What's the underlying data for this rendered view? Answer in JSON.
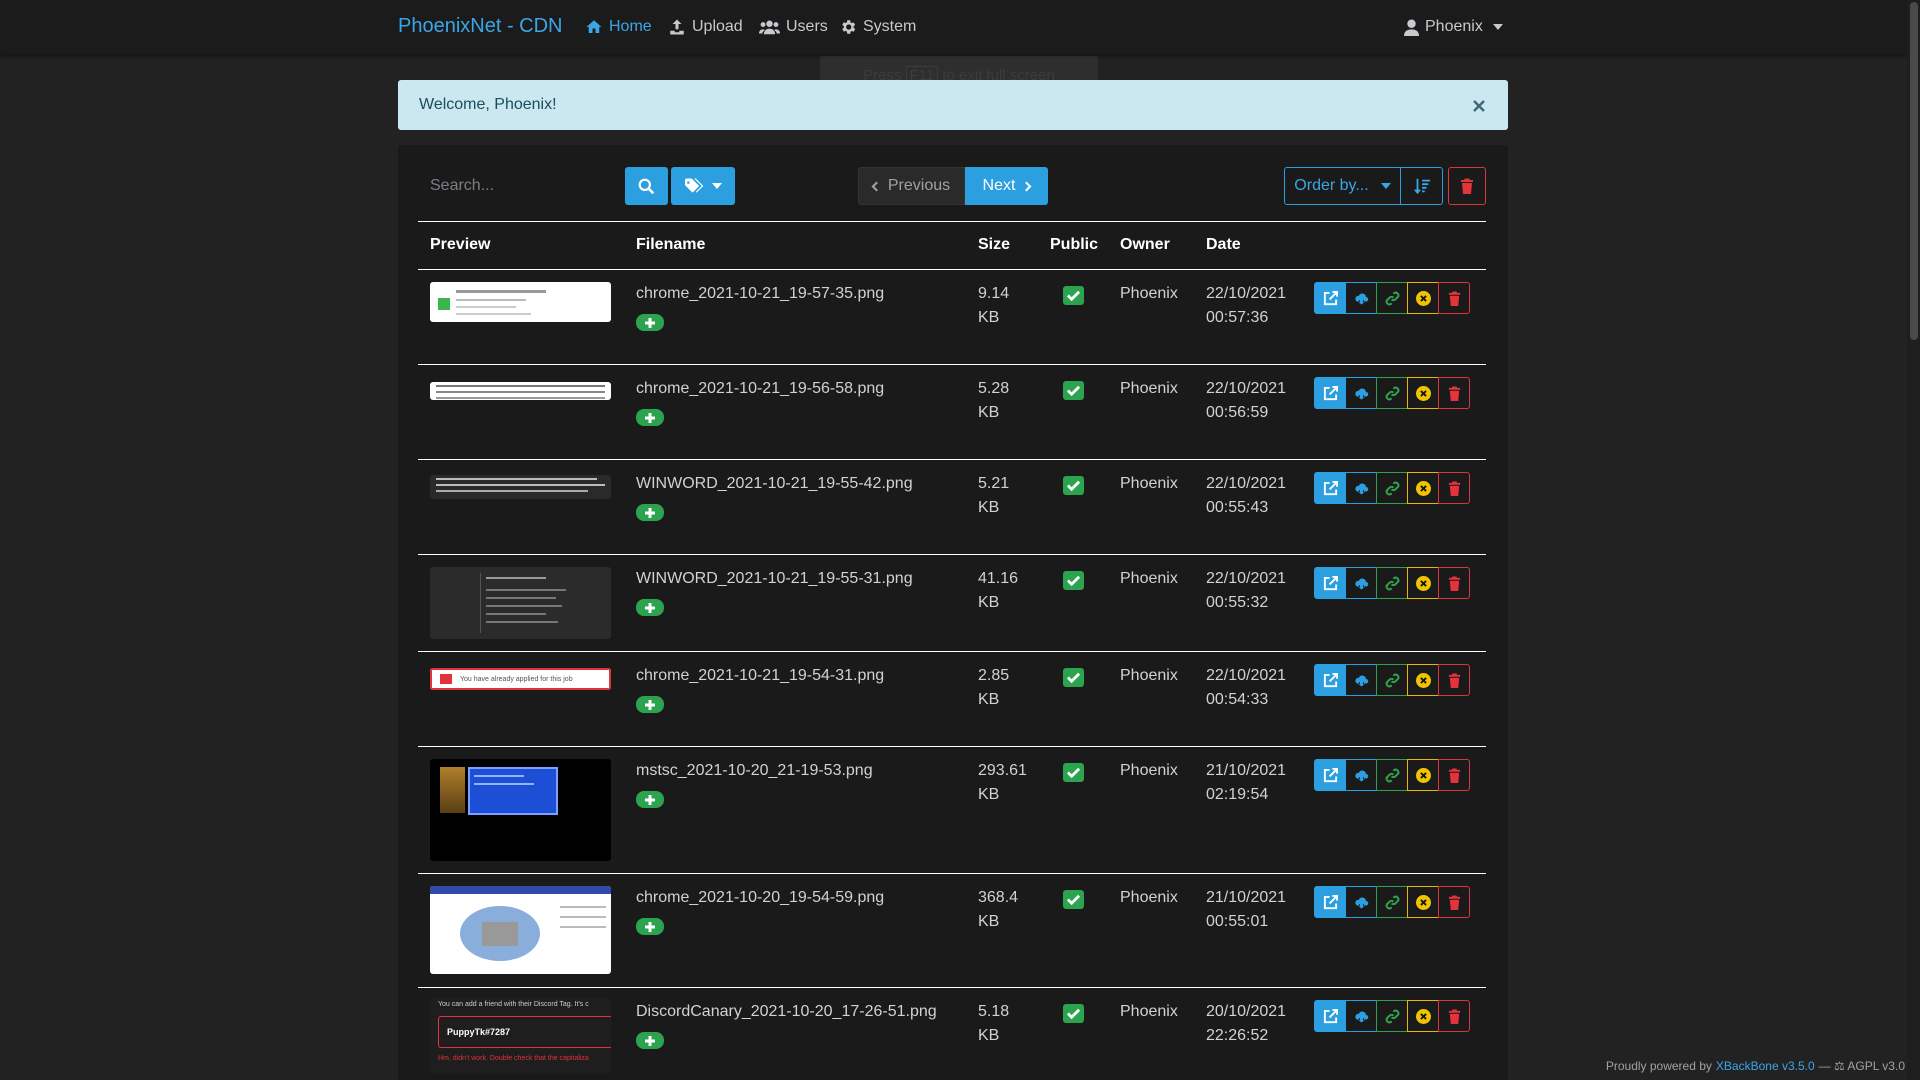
{
  "nav": {
    "brand": "PhoenixNet - CDN",
    "items": [
      {
        "label": "Home",
        "icon": "home-icon"
      },
      {
        "label": "Upload",
        "icon": "upload-icon"
      },
      {
        "label": "Users",
        "icon": "users-icon"
      },
      {
        "label": "System",
        "icon": "gear-icon"
      }
    ],
    "user": "Phoenix"
  },
  "overlay_hint": {
    "text_before": "Press",
    "key": "F11",
    "text_after": "to exit full screen"
  },
  "alert": {
    "message": "Welcome, Phoenix!"
  },
  "toolbar": {
    "search_placeholder": "Search...",
    "previous": "Previous",
    "next": "Next",
    "order_by": "Order by..."
  },
  "table": {
    "headers": [
      "Preview",
      "Filename",
      "Size",
      "Public",
      "Owner",
      "Date"
    ],
    "rows": [
      {
        "filename": "chrome_2021-10-21_19-57-35.png",
        "size": "9.14 KB",
        "public": true,
        "owner": "Phoenix",
        "date": "22/10/2021 00:57:36",
        "thumb": "light-card"
      },
      {
        "filename": "chrome_2021-10-21_19-56-58.png",
        "size": "5.28 KB",
        "public": true,
        "owner": "Phoenix",
        "date": "22/10/2021 00:56:59",
        "thumb": "light-text"
      },
      {
        "filename": "WINWORD_2021-10-21_19-55-42.png",
        "size": "5.21 KB",
        "public": true,
        "owner": "Phoenix",
        "date": "22/10/2021 00:55:43",
        "thumb": "dark-text"
      },
      {
        "filename": "WINWORD_2021-10-21_19-55-31.png",
        "size": "41.16 KB",
        "public": true,
        "owner": "Phoenix",
        "date": "22/10/2021 00:55:32",
        "thumb": "dark-doc"
      },
      {
        "filename": "chrome_2021-10-21_19-54-31.png",
        "size": "2.85 KB",
        "public": true,
        "owner": "Phoenix",
        "date": "22/10/2021 00:54:33",
        "thumb": "warning-bar"
      },
      {
        "filename": "mstsc_2021-10-20_21-19-53.png",
        "size": "293.61 KB",
        "public": true,
        "owner": "Phoenix",
        "date": "21/10/2021 02:19:54",
        "thumb": "remote-desktop"
      },
      {
        "filename": "chrome_2021-10-20_19-54-59.png",
        "size": "368.4 KB",
        "public": true,
        "owner": "Phoenix",
        "date": "21/10/2021 00:55:01",
        "thumb": "seat-map"
      },
      {
        "filename": "DiscordCanary_2021-10-20_17-26-51.png",
        "size": "5.18 KB",
        "public": true,
        "owner": "Phoenix",
        "date": "20/10/2021 22:26:52",
        "thumb": "discord"
      }
    ]
  },
  "thumb_text": {
    "warning": "You have already applied for this job",
    "discord_header": "You can add a friend with their Discord Tag. It's c",
    "discord_tag": "PuppyTk#7287",
    "discord_error": "Hm, didn't work. Double check that the capitaliza"
  },
  "footer": {
    "prefix": "Proudly powered by",
    "link": "XBackBone v3.5.0",
    "suffix": "— ⚖ AGPL v3.0"
  },
  "colors": {
    "accent": "#2c9fe0",
    "success": "#2ca34e",
    "warning": "#f2c300",
    "danger": "#e3343b"
  }
}
